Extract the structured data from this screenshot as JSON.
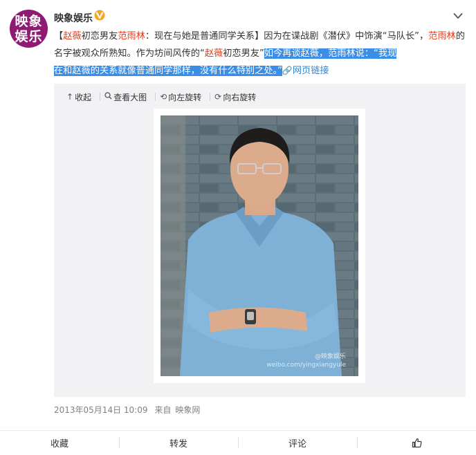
{
  "account": {
    "avatar_text_line1": "映象",
    "avatar_text_line2": "娱乐",
    "name": "映象娱乐",
    "verified_icon": "verified-v-badge-icon",
    "menu_icon": "chevron-down-icon"
  },
  "post": {
    "bracket_open": "【",
    "kw_zhaowei_1": "赵薇",
    "text_1": "初恋男友",
    "kw_fanyulin_1": "范雨林",
    "text_2": "：现在与她是普通同学关系】因为在谍战剧《潜伏》中饰演“马队长”，",
    "kw_fanyulin_2": "范雨林",
    "text_3": "的名字被观众所熟知。作为坊间风传的“",
    "kw_zhaowei_2": "赵薇",
    "text_4": "初恋男友”",
    "selected_1": "如今再谈赵薇，范雨林说：“我现",
    "selected_2": "在和赵薇的关系就像普通同学那样，没有什么特别之处。”",
    "link_label": "网页链接",
    "link_icon": "link-chain-icon"
  },
  "media_toolbar": {
    "collapse": "收起",
    "view_large": "查看大图",
    "rotate_left": "向左旋转",
    "rotate_right": "向右旋转"
  },
  "photo": {
    "watermark_handle": "@映象娱乐",
    "watermark_url": "weibo.com/yingxiangyule"
  },
  "meta": {
    "timestamp": "2013年05月14日 10:09",
    "source_prefix": "来自",
    "source": "映象网"
  },
  "actions": {
    "favorite": "收藏",
    "repost": "转发",
    "comment": "评论",
    "like_icon": "thumbs-up-icon"
  },
  "colors": {
    "highlight_red": "#e6391a",
    "selection_blue": "#3a8ee6",
    "link_blue": "#3a82c8",
    "avatar_purple": "#8e1a73",
    "verified_orange": "#f6a623"
  }
}
